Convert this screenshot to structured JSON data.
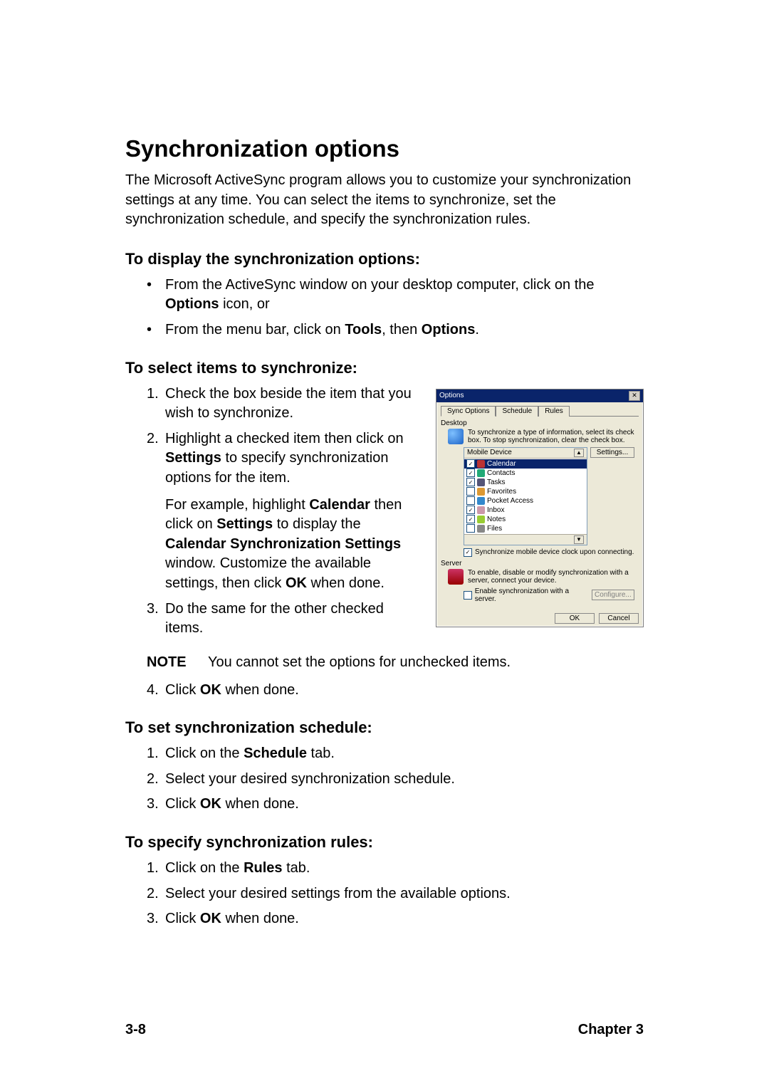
{
  "h1": "Synchronization options",
  "intro": "The Microsoft ActiveSync program allows you to customize your synchronization settings at any time. You can select the items to synchronize, set the synchronization schedule, and specify the synchronization rules.",
  "sec1": {
    "h": "To display the synchronization options:",
    "b1_a": "From the ActiveSync window on your desktop computer, click on the ",
    "b1_b": "Options",
    "b1_c": " icon, or",
    "b2_a": "From the menu bar, click on ",
    "b2_b": "Tools",
    "b2_c": ", then ",
    "b2_d": "Options",
    "b2_e": "."
  },
  "sec2": {
    "h": "To select items to synchronize:",
    "s1": "Check the box beside the item that you wish to synchronize.",
    "s2_a": "Highlight a checked item then click on ",
    "s2_b": "Settings",
    "s2_c": " to specify synchronization options for the item.",
    "s2_p2_a": "For example, highlight ",
    "s2_p2_b": "Calendar",
    "s2_p2_c": " then click on ",
    "s2_p2_d": "Settings",
    "s2_p2_e": " to display the ",
    "s2_p2_f": "Calendar Synchronization Settings",
    "s2_p2_g": " window. Customize the available settings, then click ",
    "s2_p2_h": "OK",
    "s2_p2_i": " when done.",
    "s3": "Do the same for the other checked items.",
    "note_label": "NOTE",
    "note_text": "You cannot set the options for unchecked items.",
    "s4_a": "Click ",
    "s4_b": "OK",
    "s4_c": " when done."
  },
  "sec3": {
    "h": "To set synchronization schedule:",
    "s1_a": "Click on the ",
    "s1_b": "Schedule",
    "s1_c": " tab.",
    "s2": "Select your desired synchronization schedule.",
    "s3_a": "Click ",
    "s3_b": "OK",
    "s3_c": " when done."
  },
  "sec4": {
    "h": "To specify synchronization rules:",
    "s1_a": "Click on the ",
    "s1_b": "Rules",
    "s1_c": " tab.",
    "s2": "Select your desired settings from the available options.",
    "s3_a": "Click ",
    "s3_b": "OK",
    "s3_c": " when done."
  },
  "footer": {
    "left": "3-8",
    "right": "Chapter 3"
  },
  "dialog": {
    "title": "Options",
    "tabs": [
      "Sync Options",
      "Schedule",
      "Rules"
    ],
    "section_desktop": "Desktop",
    "info_desktop": "To synchronize a type of information, select its check box. To stop synchronization, clear the check box.",
    "list_header": "Mobile Device",
    "settings_btn": "Settings...",
    "items": [
      {
        "checked": true,
        "selected": true,
        "label": "Calendar"
      },
      {
        "checked": true,
        "selected": false,
        "label": "Contacts"
      },
      {
        "checked": true,
        "selected": false,
        "label": "Tasks"
      },
      {
        "checked": false,
        "selected": false,
        "label": "Favorites"
      },
      {
        "checked": false,
        "selected": false,
        "label": "Pocket Access"
      },
      {
        "checked": true,
        "selected": false,
        "label": "Inbox"
      },
      {
        "checked": true,
        "selected": false,
        "label": "Notes"
      },
      {
        "checked": false,
        "selected": false,
        "label": "Files"
      }
    ],
    "sync_clock": "Synchronize mobile device clock upon connecting.",
    "section_server": "Server",
    "info_server": "To enable, disable or modify synchronization with a server, connect your device.",
    "enable_server": "Enable synchronization with a server.",
    "configure_btn": "Configure...",
    "ok_btn": "OK",
    "cancel_btn": "Cancel"
  }
}
